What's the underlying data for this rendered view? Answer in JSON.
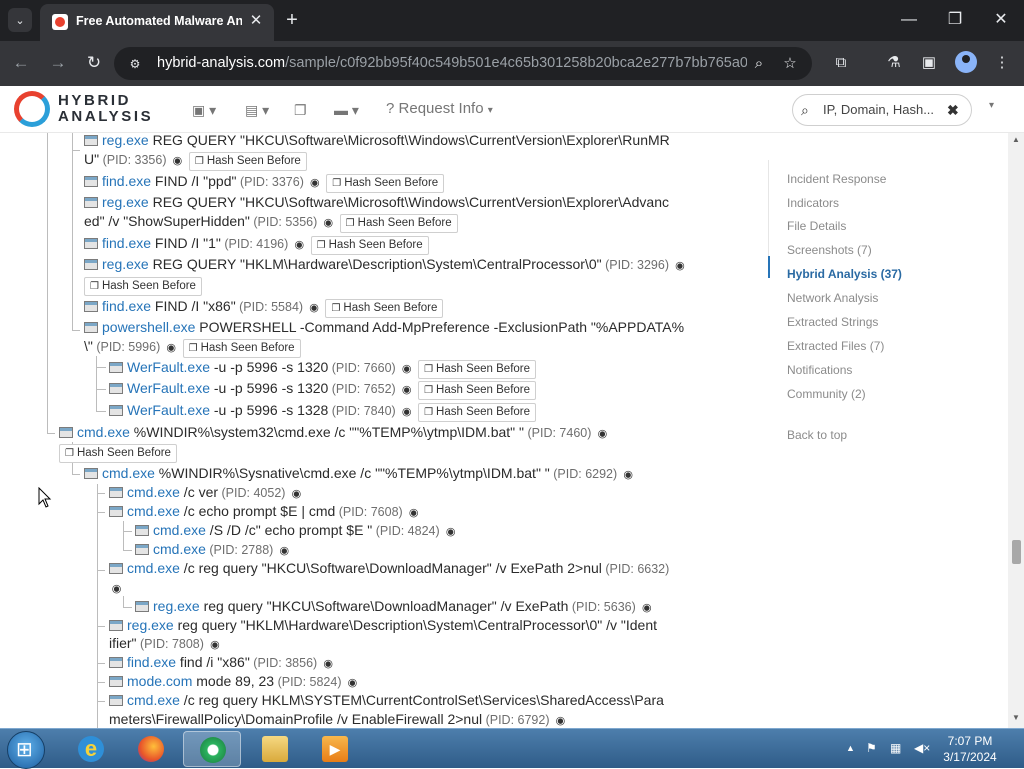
{
  "browser": {
    "tab_title": "Free Automated Malware Anal",
    "url_domain": "hybrid-analysis.com",
    "url_path": "/sample/c0f92bb95f40c549b501e4c65b301258b20bca2e277b7bb765a09..."
  },
  "site": {
    "logo_line1": "HYBRID",
    "logo_line2": "ANALYSIS",
    "request_info": "Request Info",
    "search_placeholder": "IP, Domain, Hash..."
  },
  "hash_seen_label": "Hash Seen Before",
  "tree": [
    {
      "proc": "reg.exe",
      "cmd": " REG QUERY \"HKCU\\Software\\Microsoft\\Windows\\CurrentVersion\\Explorer\\RunMR"
    },
    {
      "cmd": "U\"",
      "pid": "(PID: 3356)"
    },
    {
      "proc": "find.exe",
      "cmd": " FIND /I \"ppd\"",
      "pid": "(PID: 3376)"
    },
    {
      "proc": "reg.exe",
      "cmd": " REG QUERY \"HKCU\\Software\\Microsoft\\Windows\\CurrentVersion\\Explorer\\Advanc"
    },
    {
      "cmd": "ed\" /v \"ShowSuperHidden\"",
      "pid": "(PID: 5356)"
    },
    {
      "proc": "find.exe",
      "cmd": " FIND /I \"1\"",
      "pid": "(PID: 4196)"
    },
    {
      "proc": "reg.exe",
      "cmd": " REG QUERY \"HKLM\\Hardware\\Description\\System\\CentralProcessor\\0\"",
      "pid": "(PID: 3296)"
    },
    {
      "proc": "find.exe",
      "cmd": " FIND /I \"x86\"",
      "pid": "(PID: 5584)"
    },
    {
      "proc": "powershell.exe",
      "cmd": " POWERSHELL -Command Add-MpPreference -ExclusionPath \"%APPDATA%"
    },
    {
      "cmd": "\\\"",
      "pid": "(PID: 5996)"
    },
    {
      "proc": "WerFault.exe",
      "cmd": " -u -p 5996 -s 1320",
      "pid": "(PID: 7660)"
    },
    {
      "proc": "WerFault.exe",
      "cmd": " -u -p 5996 -s 1320",
      "pid": "(PID: 7652)"
    },
    {
      "proc": "WerFault.exe",
      "cmd": " -u -p 5996 -s 1328",
      "pid": "(PID: 7840)"
    },
    {
      "proc": "cmd.exe",
      "cmd": " %WINDIR%\\system32\\cmd.exe /c \"\"%TEMP%\\ytmp\\IDM.bat\" \"",
      "pid": "(PID: 7460)"
    },
    {
      "proc": "cmd.exe",
      "cmd": " %WINDIR%\\Sysnative\\cmd.exe /c \"\"%TEMP%\\ytmp\\IDM.bat\" \"",
      "pid": "(PID: 6292)"
    },
    {
      "proc": "cmd.exe",
      "cmd": " /c ver",
      "pid": "(PID: 4052)"
    },
    {
      "proc": "cmd.exe",
      "cmd": " /c echo prompt $E | cmd",
      "pid": "(PID: 7608)"
    },
    {
      "proc": "cmd.exe",
      "cmd": " /S /D /c\" echo prompt $E \"",
      "pid": "(PID: 4824)"
    },
    {
      "proc": "cmd.exe",
      "cmd": "",
      "pid": "(PID: 2788)"
    },
    {
      "proc": "cmd.exe",
      "cmd": " /c reg query \"HKCU\\Software\\DownloadManager\" /v ExePath 2>nul",
      "pid": "(PID: 6632)"
    },
    {
      "proc": "reg.exe",
      "cmd": " reg query \"HKCU\\Software\\DownloadManager\" /v ExePath",
      "pid": "(PID: 5636)"
    },
    {
      "proc": "reg.exe",
      "cmd": " reg query \"HKLM\\Hardware\\Description\\System\\CentralProcessor\\0\" /v \"Ident"
    },
    {
      "cmd": "ifier\"",
      "pid": "(PID: 7808)"
    },
    {
      "proc": "find.exe",
      "cmd": " find /i \"x86\"",
      "pid": "(PID: 3856)"
    },
    {
      "proc": "mode.com",
      "cmd": " mode 89, 23",
      "pid": "(PID: 5824)"
    },
    {
      "proc": "cmd.exe",
      "cmd": " /c reg query HKLM\\SYSTEM\\CurrentControlSet\\Services\\SharedAccess\\Para"
    },
    {
      "cmd": "meters\\FirewallPolicy\\DomainProfile /v EnableFirewall 2>nul",
      "pid": "(PID: 6792)"
    }
  ],
  "page_nav": [
    {
      "label": "Incident Response"
    },
    {
      "label": "Indicators"
    },
    {
      "label": "File Details"
    },
    {
      "label": "Screenshots (7)"
    },
    {
      "label": "Hybrid Analysis (37)",
      "active": true
    },
    {
      "label": "Network Analysis"
    },
    {
      "label": "Extracted Strings"
    },
    {
      "label": "Extracted Files (7)"
    },
    {
      "label": "Notifications"
    },
    {
      "label": "Community (2)"
    },
    {
      "label": "Back to top"
    }
  ],
  "taskbar": {
    "time": "7:07 PM",
    "date": "3/17/2024"
  },
  "colors": {
    "link": "#2674b8",
    "active_nav": "#2a6aa3",
    "chrome_dark": "#202124"
  }
}
